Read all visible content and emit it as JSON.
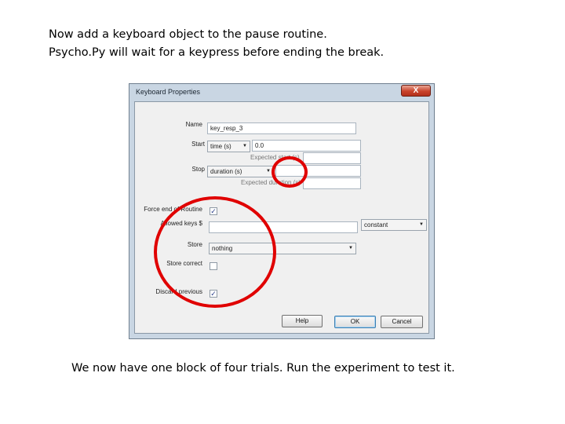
{
  "slide": {
    "intro_line1": "Now add a keyboard object to the pause routine.",
    "intro_line2": "Psycho.Py will wait for a keypress before ending the break.",
    "outro": "We now have one block of four trials.  Run the experiment to test it."
  },
  "dialog": {
    "title": "Keyboard Properties",
    "close_label": "X",
    "name_label": "Name",
    "name_value": "key_resp_3",
    "start_label": "Start",
    "start_type": "time (s)",
    "start_value": "0.0",
    "expected_start_hint": "Expected start (s)",
    "stop_label": "Stop",
    "stop_type": "duration (s)",
    "stop_value": "",
    "expected_duration_hint": "Expected duration (s)",
    "force_end_label": "Force end of Routine",
    "force_end_checked": true,
    "allowed_keys_label": "Allowed keys $",
    "allowed_keys_value": "",
    "allowed_keys_mode": "constant",
    "store_label": "Store",
    "store_value": "nothing",
    "store_correct_label": "Store correct",
    "store_correct_checked": false,
    "discard_previous_label": "Discard previous",
    "discard_previous_checked": true,
    "help_button": "Help",
    "ok_button": "OK",
    "cancel_button": "Cancel"
  },
  "colors": {
    "annotation_ring": "#e00000",
    "window_frame": "#c9d6e3",
    "close_button": "#c9432b"
  }
}
